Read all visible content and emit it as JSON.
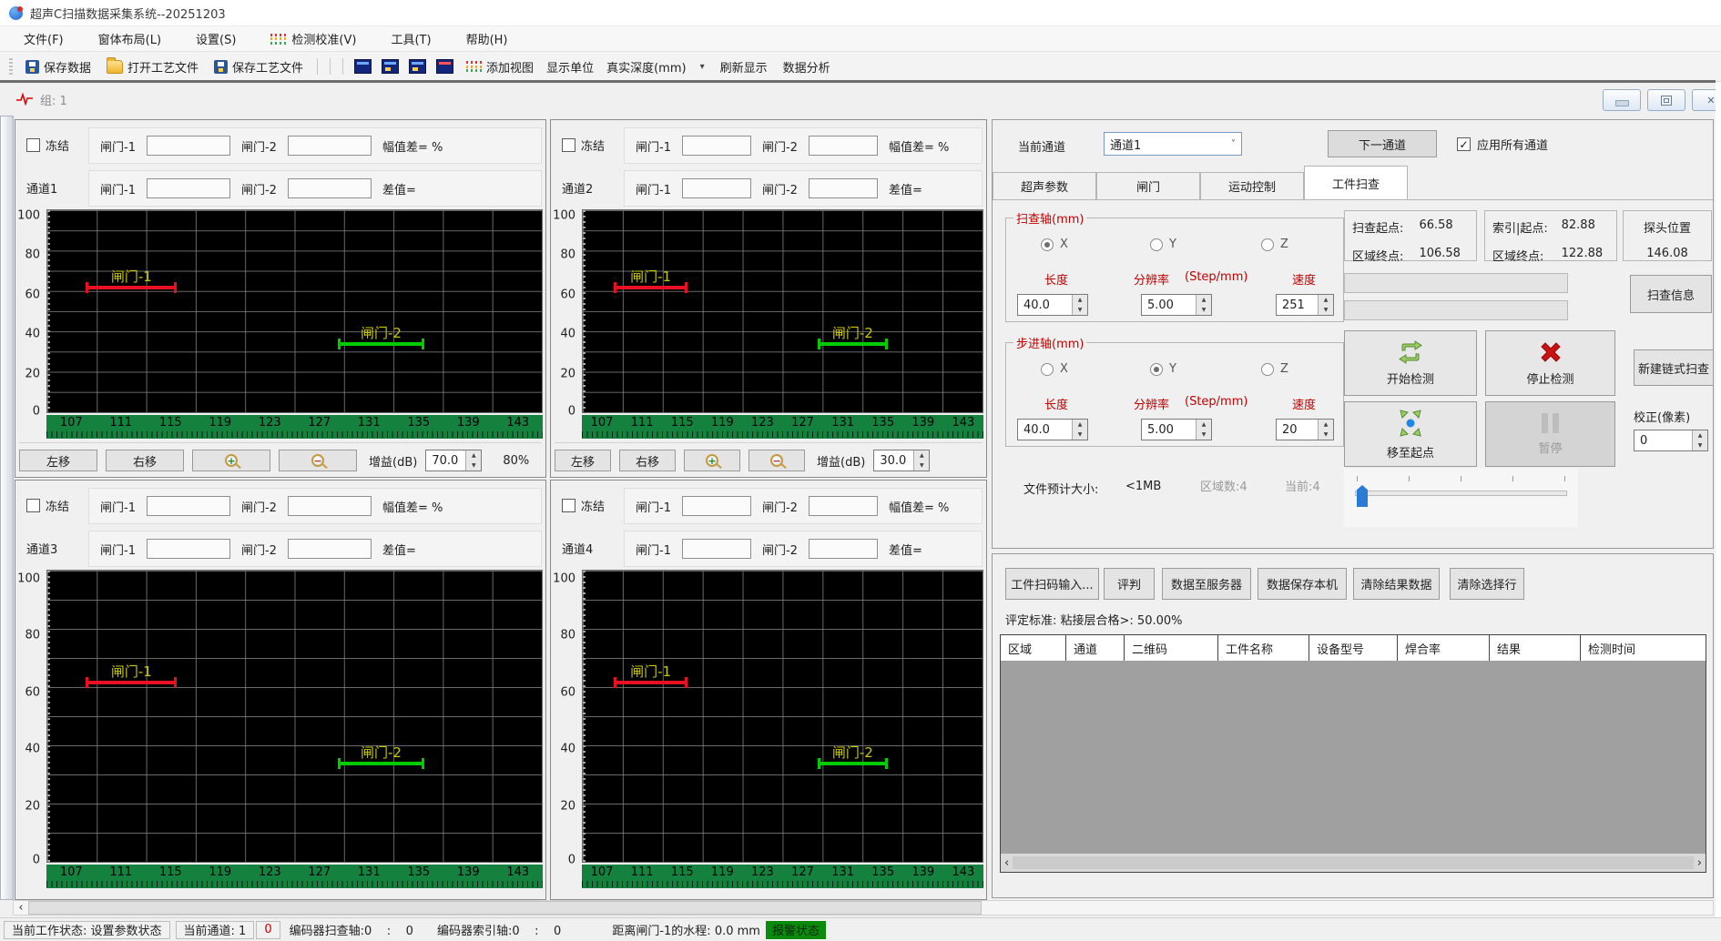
{
  "window": {
    "title": "超声C扫描数据采集系统--20251203"
  },
  "menu": {
    "items": [
      "文件(F)",
      "窗体布局(L)",
      "设置(S)",
      "检测校准(V)",
      "工具(T)",
      "帮助(H)"
    ]
  },
  "toolbar": {
    "save_data": "保存数据",
    "open_process": "打开工艺文件",
    "save_process": "保存工艺文件",
    "add_view": "添加视图",
    "display_unit": "显示单位",
    "true_depth": "真实深度(mm)",
    "refresh": "刷新显示",
    "analysis": "数据分析"
  },
  "group": {
    "title": "组: 1"
  },
  "plot": {
    "y_ticks": [
      "100",
      "80",
      "60",
      "40",
      "20",
      "0"
    ],
    "x_ticks": [
      "107",
      "111",
      "115",
      "119",
      "123",
      "127",
      "131",
      "135",
      "139",
      "143"
    ],
    "label_color": "#c8c800",
    "gates": [
      {
        "name": "gate-1",
        "label": "闸门-1",
        "color": "#e81123",
        "value": 61,
        "left_pct": 8,
        "width_pct": 18
      },
      {
        "name": "gate-2",
        "label": "闸门-2",
        "color": "#00cc00",
        "value": 33,
        "left_pct": 59,
        "width_pct": 17
      }
    ]
  },
  "channel_common": {
    "freeze": "冻结",
    "gate1": "闸门-1",
    "gate2": "闸门-2",
    "amp_diff": "幅值差= %",
    "diff": "差值=",
    "move_left": "左移",
    "move_right": "右移",
    "gain_label": "增益(dB)"
  },
  "channels": [
    {
      "name": "通道1",
      "gain": "70.0",
      "range_pct": "80%"
    },
    {
      "name": "通道2",
      "gain": "30.0",
      "range_pct": ""
    },
    {
      "name": "通道3"
    },
    {
      "name": "通道4"
    }
  ],
  "right_panel": {
    "current_channel_label": "当前通道",
    "current_channel_value": "通道1",
    "next_channel": "下一通道",
    "apply_all": "应用所有通道",
    "tabs": [
      "超声参数",
      "闸门",
      "运动控制",
      "工件扫查"
    ],
    "scan_axis": {
      "title": "扫查轴(mm)",
      "axes": [
        "X",
        "Y",
        "Z"
      ],
      "len_label": "长度",
      "res_label": "分辨率",
      "res_unit": "(Step/mm)",
      "speed_label": "速度",
      "length": "40.0",
      "resolution": "5.00",
      "speed": "251"
    },
    "step_axis": {
      "title": "步进轴(mm)",
      "axes": [
        "X",
        "Y",
        "Z"
      ],
      "len_label": "长度",
      "res_label": "分辨率",
      "res_unit": "(Step/mm)",
      "speed_label": "速度",
      "length": "40.0",
      "resolution": "5.00",
      "speed": "20"
    },
    "scan_start_label": "扫查起点:",
    "scan_start": "66.58",
    "scan_end_label": "区域终点:",
    "scan_end": "106.58",
    "index_start_label": "索引|起点:",
    "index_start": "82.88",
    "index_end_label": "区域终点:",
    "index_end": "122.88",
    "probe_label": "探头位置",
    "probe_value": "146.08",
    "scan_info_btn": "扫查信息",
    "start_btn": "开始检测",
    "stop_btn": "停止检测",
    "new_chain_btn": "新建链式扫查",
    "move_origin_btn": "移至起点",
    "pause_btn": "暂停",
    "calib_label": "校正(像素)",
    "calib_value": "0",
    "file_size_label": "文件预计大小:",
    "file_size": "<1MB",
    "region_count": "区域数:4",
    "current_region": "当前:4"
  },
  "results": {
    "btn_scan_input": "工件扫码输入...",
    "btn_judge": "评判",
    "btn_to_server": "数据至服务器",
    "btn_save_local": "数据保存本机",
    "btn_clear_results": "清除结果数据",
    "btn_clear_row": "清除选择行",
    "standard": "评定标准: 粘接层合格>: 50.00%",
    "columns": [
      "区域",
      "通道",
      "二维码",
      "工件名称",
      "设备型号",
      "焊合率",
      "结果",
      "检测时间"
    ]
  },
  "status": {
    "work_state": "当前工作状态: 设置参数状态",
    "channel": "当前通道: 1",
    "zero": "0",
    "encoder_scan": "编码器扫查轴:0    :    0",
    "encoder_index": "编码器索引轴:0    :    0",
    "gate_distance": "距离闸门-1的水程: 0.0 mm",
    "alarm": "报警状态"
  },
  "colors": {
    "accent_red": "#c00000",
    "gate1": "#e81123",
    "gate2": "#00cc00",
    "ruler_green": "#15813f",
    "alarm_green": "#0b8a0b",
    "gate_label_yellow": "#c8c800"
  }
}
